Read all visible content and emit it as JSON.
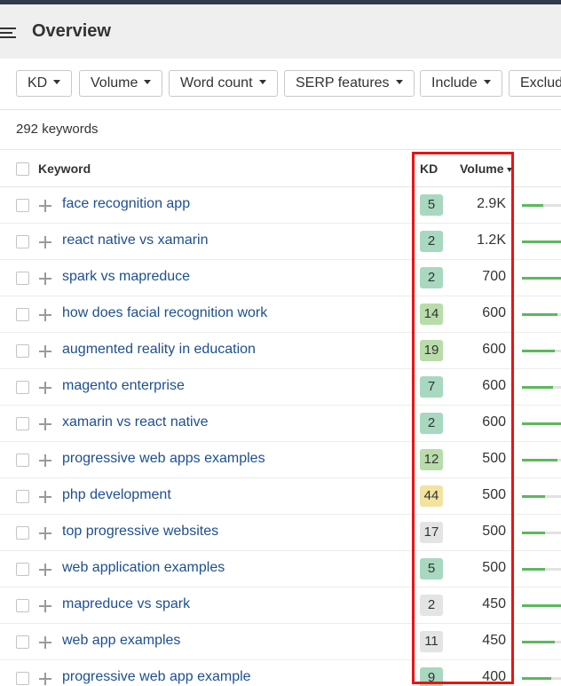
{
  "header": {
    "title": "Overview"
  },
  "filters": [
    {
      "label": "KD"
    },
    {
      "label": "Volume"
    },
    {
      "label": "Word count"
    },
    {
      "label": "SERP features"
    },
    {
      "label": "Include"
    },
    {
      "label": "Exclude"
    }
  ],
  "summary": {
    "keyword_count": "292 keywords"
  },
  "table": {
    "headers": {
      "keyword": "Keyword",
      "kd": "KD",
      "volume": "Volume"
    },
    "sort": {
      "column": "Volume",
      "direction": "descending"
    },
    "rows": [
      {
        "keyword": "face recognition app",
        "kd": "5",
        "kd_color": "#a8d8c0",
        "volume": "2.9K",
        "trend": 0.55
      },
      {
        "keyword": "react native vs xamarin",
        "kd": "2",
        "kd_color": "#a8d8c0",
        "volume": "1.2K",
        "trend": 1.0
      },
      {
        "keyword": "spark vs mapreduce",
        "kd": "2",
        "kd_color": "#a8d8c0",
        "volume": "700",
        "trend": 1.0
      },
      {
        "keyword": "how does facial recognition work",
        "kd": "14",
        "kd_color": "#b9dcab",
        "volume": "600",
        "trend": 0.9
      },
      {
        "keyword": "augmented reality in education",
        "kd": "19",
        "kd_color": "#b9dcab",
        "volume": "600",
        "trend": 0.85
      },
      {
        "keyword": "magento enterprise",
        "kd": "7",
        "kd_color": "#a8d8c0",
        "volume": "600",
        "trend": 0.8
      },
      {
        "keyword": "xamarin vs react native",
        "kd": "2",
        "kd_color": "#a8d8c0",
        "volume": "600",
        "trend": 1.0
      },
      {
        "keyword": "progressive web apps examples",
        "kd": "12",
        "kd_color": "#b9dcab",
        "volume": "500",
        "trend": 0.9
      },
      {
        "keyword": "php development",
        "kd": "44",
        "kd_color": "#f3e3a0",
        "volume": "500",
        "trend": 0.6
      },
      {
        "keyword": "top progressive websites",
        "kd": "17",
        "kd_color": "#e4e4e4",
        "volume": "500",
        "trend": 0.6
      },
      {
        "keyword": "web application examples",
        "kd": "5",
        "kd_color": "#a8d8c0",
        "volume": "500",
        "trend": 0.6
      },
      {
        "keyword": "mapreduce vs spark",
        "kd": "2",
        "kd_color": "#e4e4e4",
        "volume": "450",
        "trend": 1.0
      },
      {
        "keyword": "web app examples",
        "kd": "11",
        "kd_color": "#e4e4e4",
        "volume": "450",
        "trend": 0.85
      },
      {
        "keyword": "progressive web app example",
        "kd": "9",
        "kd_color": "#a8d8c0",
        "volume": "400",
        "trend": 0.75
      }
    ]
  },
  "colors": {
    "link": "#1d4f91",
    "highlight_box": "#ee1111",
    "trend_bar": "#5cb85c"
  }
}
